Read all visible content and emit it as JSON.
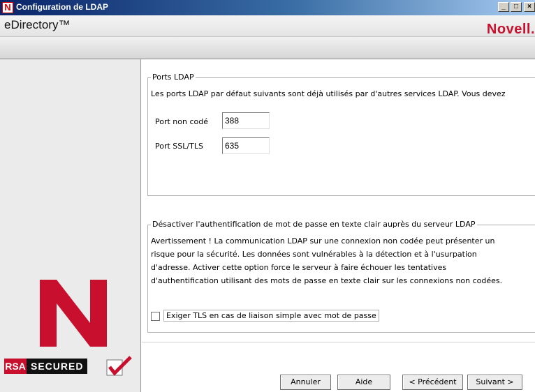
{
  "window": {
    "icon_letter": "N",
    "title": "Configuration de LDAP",
    "minimize_glyph": "_",
    "maximize_glyph": "□",
    "close_glyph": "×"
  },
  "header": {
    "product": "eDirectory™",
    "brand": "Novell."
  },
  "left_panel": {
    "rsa_prefix": "RSA",
    "rsa_suffix": "SECURED"
  },
  "ports_group": {
    "title": "Ports LDAP",
    "description": "Les ports LDAP par défaut suivants sont déjà utilisés par d'autres services LDAP. Vous devez",
    "clear_port_label": "Port non codé",
    "clear_port_value": "388",
    "ssl_port_label": "Port SSL/TLS",
    "ssl_port_value": "635"
  },
  "auth_group": {
    "title": "Désactiver l'authentification de mot de passe en texte clair auprès du serveur LDAP",
    "warning_lines": [
      "Avertissement ! La communication LDAP sur une connexion non codée peut présenter un",
      "risque pour la sécurité. Les données sont vulnérables à la détection et à l'usurpation",
      "d'adresse. Activer cette option force le serveur à faire échouer les tentatives",
      "d'authentification utilisant des mots de passe en texte clair sur les connexions non codées."
    ],
    "require_tls_label": "Exiger TLS en cas de liaison simple avec mot de passe",
    "require_tls_checked": false
  },
  "buttons": {
    "cancel": "Annuler",
    "help": "Aide",
    "back": "< Précédent",
    "next": "Suivant >"
  },
  "colors": {
    "brand_red": "#c8102e",
    "title_bar": "#0a246a",
    "panel_gray": "#ebebeb"
  }
}
